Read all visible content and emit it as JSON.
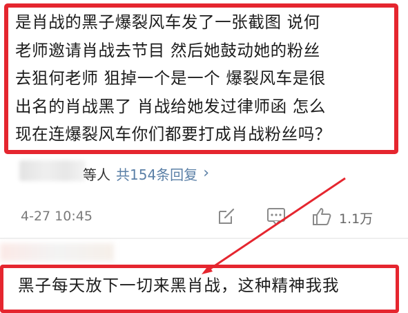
{
  "comment": {
    "text": "是肖战的黑子爆裂风车发了一张截图 说何\n老师邀请肖战去节目 然后她鼓动她的粉丝\n去狙何老师 狙掉一个是一个 爆裂风车是很\n出名的肖战黑了 肖战给她发过律师函 怎么\n现在连爆裂风车你们都要打成肖战粉丝吗？"
  },
  "replies": {
    "prefix": "等人",
    "link": "共154条回复",
    "chevron": "›"
  },
  "meta": {
    "timestamp": "4-27 10:45",
    "like_count": "1.1万"
  },
  "comment2": {
    "text": "黑子每天放下一切来黑肖战，这种精神我我"
  },
  "colors": {
    "highlight": "#e5262f",
    "link": "#5a7fa6",
    "meta_text": "#7a7a7a"
  },
  "icons": [
    "edit-icon",
    "comment-icon",
    "like-icon",
    "chevron-right-icon"
  ]
}
